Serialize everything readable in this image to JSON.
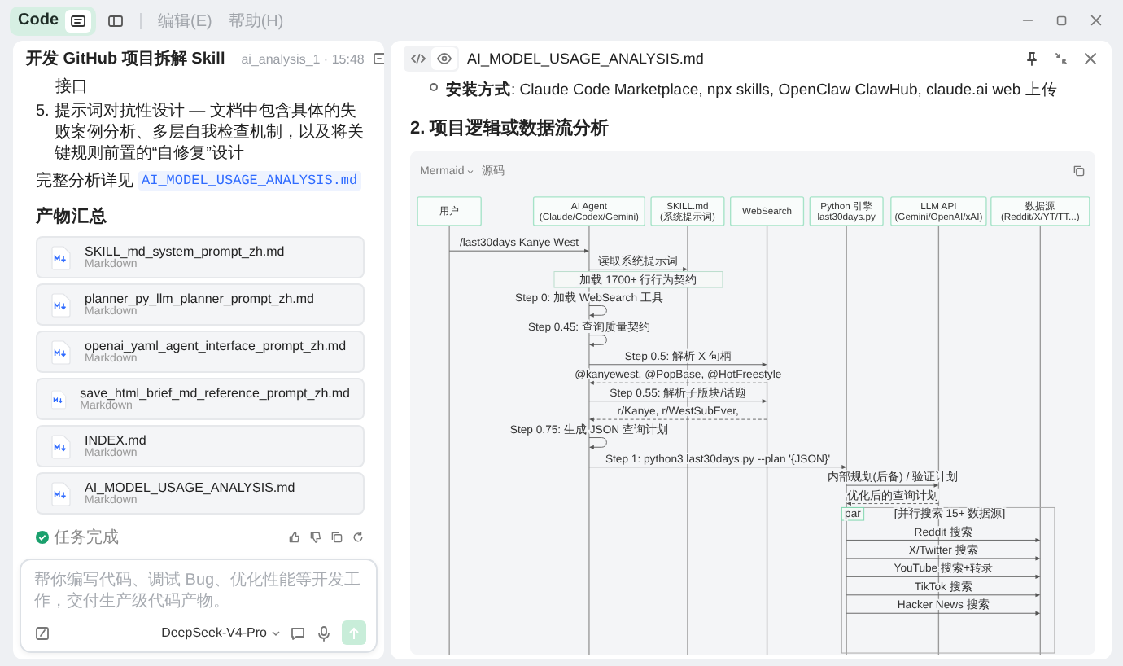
{
  "toolbar": {
    "app_label": "Code",
    "menus": [
      "编辑(E)",
      "帮助(H)"
    ]
  },
  "chat": {
    "title": "开发 GitHub 项目拆解 Skill",
    "meta": "ai_analysis_1 · 15:48",
    "continuation": "接口",
    "list_item": {
      "number": "5.",
      "text": "提示词对抗性设计 — 文档中包含具体的失败案例分析、多层自我检查机制，以及将关键规则前置的“自修复”设计"
    },
    "detail": {
      "text": "完整分析详见",
      "link": "AI_MODEL_USAGE_ANALYSIS.md"
    },
    "section_title": "产物汇总",
    "files": [
      {
        "name": "SKILL_md_system_prompt_zh.md",
        "type": "Markdown"
      },
      {
        "name": "planner_py_llm_planner_prompt_zh.md",
        "type": "Markdown"
      },
      {
        "name": "openai_yaml_agent_interface_prompt_zh.md",
        "type": "Markdown"
      },
      {
        "name": "save_html_brief_md_reference_prompt_zh.md",
        "type": "Markdown"
      },
      {
        "name": "INDEX.md",
        "type": "Markdown"
      },
      {
        "name": "AI_MODEL_USAGE_ANALYSIS.md",
        "type": "Markdown"
      }
    ],
    "status": "任务完成",
    "input": {
      "placeholder": "帮你编写代码、调试 Bug、优化性能等开发工作，交付生产级代码产物。",
      "model": "DeepSeek-V4-Pro"
    }
  },
  "document": {
    "title": "AI_MODEL_USAGE_ANALYSIS.md",
    "bullet": "**安装方式**: Claude Code Marketplace, npx skills, OpenClaw ClawHub, claude.ai web 上传",
    "heading": "2. 项目逻辑或数据流分析",
    "code_block": {
      "language": "Mermaid",
      "source_label": "源码",
      "participants": [
        {
          "lines": [
            "用户"
          ]
        },
        {
          "lines": [
            "AI Agent",
            "(Claude/Codex/Gemini)"
          ]
        },
        {
          "lines": [
            "SKILL.md",
            "(系统提示词)"
          ]
        },
        {
          "lines": [
            "WebSearch"
          ]
        },
        {
          "lines": [
            "Python 引擎",
            "last30days.py"
          ]
        },
        {
          "lines": [
            "LLM API",
            "(Gemini/OpenAI/xAI)"
          ]
        },
        {
          "lines": [
            "数据源",
            "(Reddit/X/YT/TT...)"
          ]
        }
      ],
      "messages": [
        {
          "kind": "call",
          "label": "/last30days Kanye West"
        },
        {
          "kind": "call",
          "label": "读取系统提示词"
        },
        {
          "kind": "note",
          "label": "加载 1700+ 行行为契约"
        },
        {
          "kind": "self",
          "label": "Step 0: 加载 WebSearch 工具"
        },
        {
          "kind": "self",
          "label": "Step 0.45: 查询质量契约"
        },
        {
          "kind": "call",
          "label": "Step 0.5: 解析 X 句柄"
        },
        {
          "kind": "reply",
          "label": "@kanyewest, @PopBase, @HotFreestyle"
        },
        {
          "kind": "call",
          "label": "Step 0.55: 解析子版块/话题"
        },
        {
          "kind": "reply",
          "label": "r/Kanye, r/WestSubEver,"
        },
        {
          "kind": "self",
          "label": "Step 0.75: 生成 JSON 查询计划"
        },
        {
          "kind": "call",
          "label": "Step 1: python3 last30days.py --plan '{JSON}'"
        },
        {
          "kind": "call",
          "label": "内部规划(后备) / 验证计划"
        },
        {
          "kind": "reply",
          "label": "优化后的查询计划"
        },
        {
          "kind": "par",
          "tag": "par",
          "label": "[并行搜索 15+ 数据源]"
        },
        {
          "kind": "call",
          "label": "Reddit 搜索"
        },
        {
          "kind": "call",
          "label": "X/Twitter 搜索"
        },
        {
          "kind": "call",
          "label": "YouTube 搜索+转录"
        },
        {
          "kind": "call",
          "label": "TikTok 搜索"
        },
        {
          "kind": "call",
          "label": "Hacker News 搜索"
        }
      ]
    }
  }
}
